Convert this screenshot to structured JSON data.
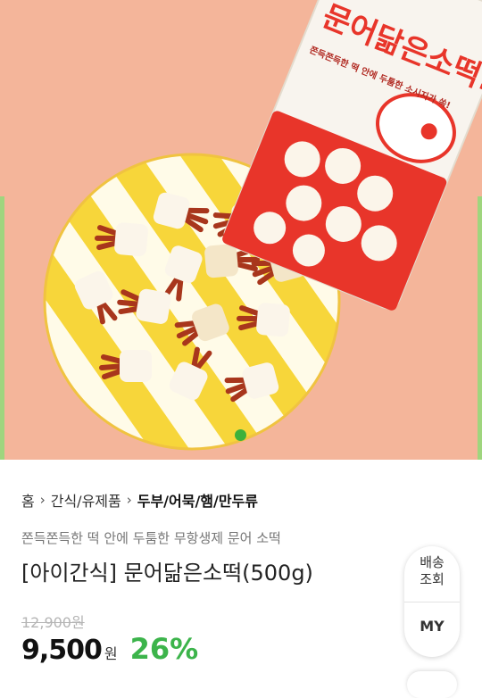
{
  "product_image": {
    "package_brand": "문어닮은소떡!",
    "package_tagline": "쫀득쫀득한 떡 안에 두툼한 소시지가 쏙!",
    "accent_colors": [
      "#f4b59a",
      "#e8352a",
      "#f7d63a"
    ]
  },
  "breadcrumb": {
    "home": "홈",
    "sep": "›",
    "category": "간식/유제품",
    "current": "두부/어묵/햄/만두류"
  },
  "product": {
    "subtitle": "쫀득쫀득한 떡 안에 두툼한 무항생제 문어 소떡",
    "title": "[아이간식] 문어닮은소떡(500g)",
    "original_price": "12,900원",
    "price": "9,500",
    "currency": "원",
    "discount": "26%"
  },
  "floating_menu": {
    "shipping_line1": "배송",
    "shipping_line2": "조회",
    "my": "MY"
  }
}
